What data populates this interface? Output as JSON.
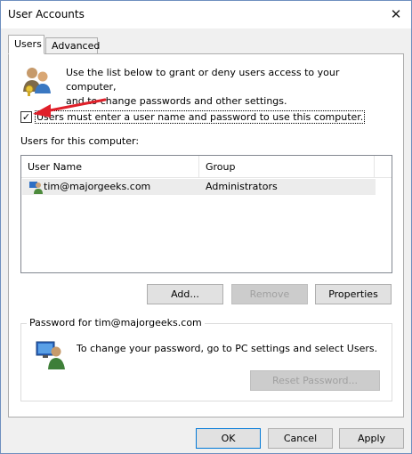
{
  "window": {
    "title": "User Accounts"
  },
  "tabs": [
    {
      "label": "Users"
    },
    {
      "label": "Advanced"
    }
  ],
  "intro": {
    "line1": "Use the list below to grant or deny users access to your computer,",
    "line2": "and to change passwords and other settings."
  },
  "checkbox": {
    "checked": true,
    "label": "Users must enter a user name and password to use this computer."
  },
  "users_list": {
    "heading": "Users for this computer:",
    "columns": [
      "User Name",
      "Group"
    ],
    "rows": [
      {
        "user": "tim@majorgeeks.com",
        "group": "Administrators"
      }
    ]
  },
  "buttons": {
    "add": "Add...",
    "remove": "Remove",
    "properties": "Properties"
  },
  "password_group": {
    "title": "Password for tim@majorgeeks.com",
    "text": "To change your password, go to PC settings and select Users.",
    "reset": "Reset Password..."
  },
  "footer": {
    "ok": "OK",
    "cancel": "Cancel",
    "apply": "Apply"
  },
  "colors": {
    "arrow": "#e0202a",
    "accent": "#0078d7"
  }
}
